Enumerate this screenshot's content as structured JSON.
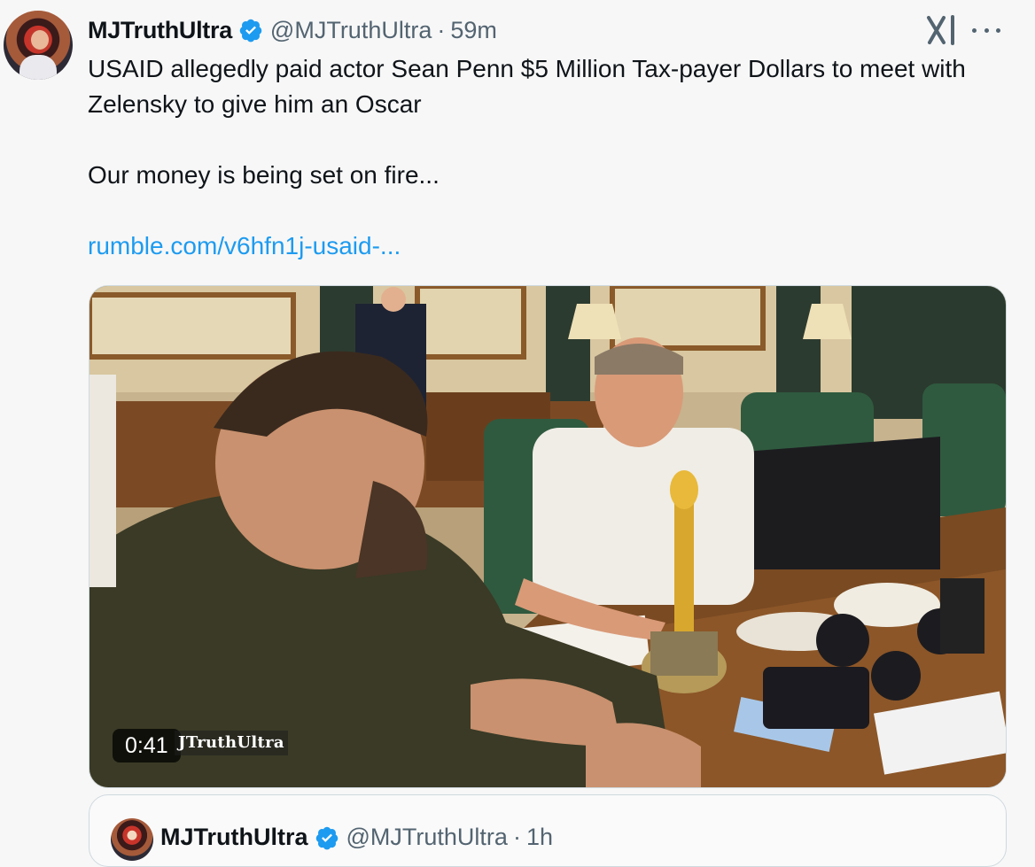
{
  "tweet": {
    "display_name": "MJTruthUltra",
    "handle": "@MJTruthUltra",
    "separator": "·",
    "time": "59m",
    "text_line1": "USAID allegedly paid actor Sean Penn $5 Million Tax-payer Dollars to meet with Zelensky to give him an Oscar",
    "text_line2": "Our money is being set on fire...",
    "link": "rumble.com/v6hfn1j-usaid-...",
    "video": {
      "duration": "0:41",
      "watermark": "JTruthUltra"
    }
  },
  "quoted_tweet": {
    "display_name": "MJTruthUltra",
    "handle": "@MJTruthUltra",
    "separator": "·",
    "time": "1h"
  },
  "icons": {
    "verified": "verified-badge-icon",
    "grok": "grok-icon",
    "more": "more-options-icon"
  },
  "colors": {
    "link": "#1d9bf0",
    "verified": "#1d9bf0",
    "secondary_text": "#536471"
  }
}
